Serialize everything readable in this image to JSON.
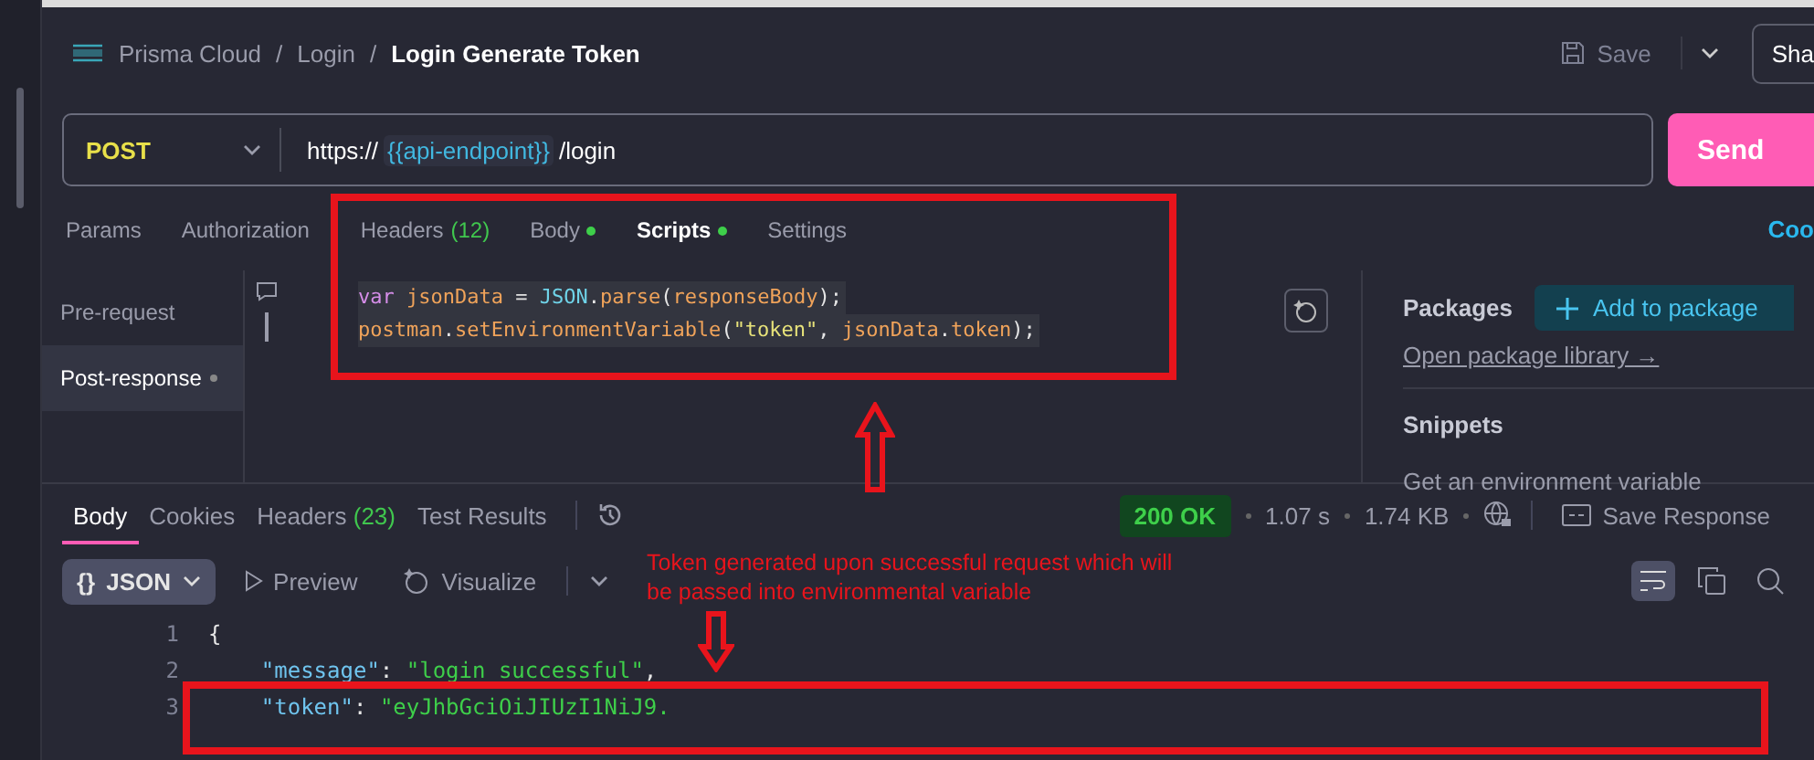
{
  "breadcrumb": {
    "items": [
      "Prisma Cloud",
      "Login"
    ],
    "separator": "/",
    "current": "Login Generate Token"
  },
  "header_actions": {
    "save": "Save",
    "share": "Sha"
  },
  "request": {
    "method": "POST",
    "url_prefix": "https://",
    "url_variable": "{{api-endpoint}}",
    "url_suffix": "/login",
    "send": "Send"
  },
  "tabs": [
    {
      "label": "Params",
      "dot": false,
      "selected": false
    },
    {
      "label": "Authorization",
      "dot": false,
      "selected": false
    },
    {
      "label": "Headers",
      "count": "(12)",
      "dot": false,
      "selected": false
    },
    {
      "label": "Body",
      "dot": true,
      "selected": false
    },
    {
      "label": "Scripts",
      "dot": true,
      "selected": true
    },
    {
      "label": "Settings",
      "dot": false,
      "selected": false
    }
  ],
  "cookies_link": "Coo",
  "script_nav": [
    {
      "label": "Pre-request",
      "dot": false,
      "selected": false
    },
    {
      "label": "Post-response",
      "dot": true,
      "selected": true
    }
  ],
  "script_lines": [
    [
      {
        "kind": "keyword",
        "text": "var"
      },
      {
        "kind": "ident",
        "text": " jsonData "
      },
      {
        "kind": "op",
        "text": "="
      },
      {
        "kind": "builtin",
        "text": " JSON"
      },
      {
        "kind": "punct",
        "text": "."
      },
      {
        "kind": "ident",
        "text": "parse"
      },
      {
        "kind": "punct",
        "text": "("
      },
      {
        "kind": "ident",
        "text": "responseBody"
      },
      {
        "kind": "punct",
        "text": ");"
      }
    ],
    [
      {
        "kind": "ident",
        "text": "postman"
      },
      {
        "kind": "punct",
        "text": "."
      },
      {
        "kind": "ident",
        "text": "setEnvironmentVariable"
      },
      {
        "kind": "punct",
        "text": "("
      },
      {
        "kind": "string",
        "text": "\"token\""
      },
      {
        "kind": "punct",
        "text": ", "
      },
      {
        "kind": "ident",
        "text": "jsonData"
      },
      {
        "kind": "punct",
        "text": "."
      },
      {
        "kind": "ident",
        "text": "token"
      },
      {
        "kind": "punct",
        "text": ");"
      }
    ]
  ],
  "side_panel": {
    "packages": "Packages",
    "add_package": "Add to package",
    "open_library": "Open package library →",
    "snippets": "Snippets",
    "snippet_items": [
      "Get an environment variable"
    ]
  },
  "response_tabs": [
    {
      "label": "Body",
      "selected": true
    },
    {
      "label": "Cookies",
      "selected": false
    },
    {
      "label": "Headers",
      "count": "(23)",
      "selected": false
    },
    {
      "label": "Test Results",
      "selected": false
    }
  ],
  "response_meta": {
    "status": "200 OK",
    "time": "1.07 s",
    "size": "1.74 KB",
    "save_response": "Save Response"
  },
  "view_modes": {
    "format": "JSON",
    "format_glyph": "{}",
    "preview": "Preview",
    "visualize": "Visualize"
  },
  "response_lines": [
    {
      "number": "1",
      "segments": [
        {
          "kind": "punct",
          "text": "{"
        }
      ]
    },
    {
      "number": "2",
      "segments": [
        {
          "kind": "key",
          "text": "    \"message\""
        },
        {
          "kind": "punct",
          "text": ": "
        },
        {
          "kind": "string",
          "text": "\"login successful\""
        },
        {
          "kind": "punct",
          "text": ","
        }
      ]
    },
    {
      "number": "3",
      "segments": [
        {
          "kind": "key",
          "text": "    \"token\""
        },
        {
          "kind": "punct",
          "text": ": "
        },
        {
          "kind": "string",
          "text": "\"eyJhbGciOiJIUzI1NiJ9."
        }
      ]
    }
  ],
  "annotation": {
    "note": "Token generated upon successful request which will be passed into environmental variable"
  }
}
